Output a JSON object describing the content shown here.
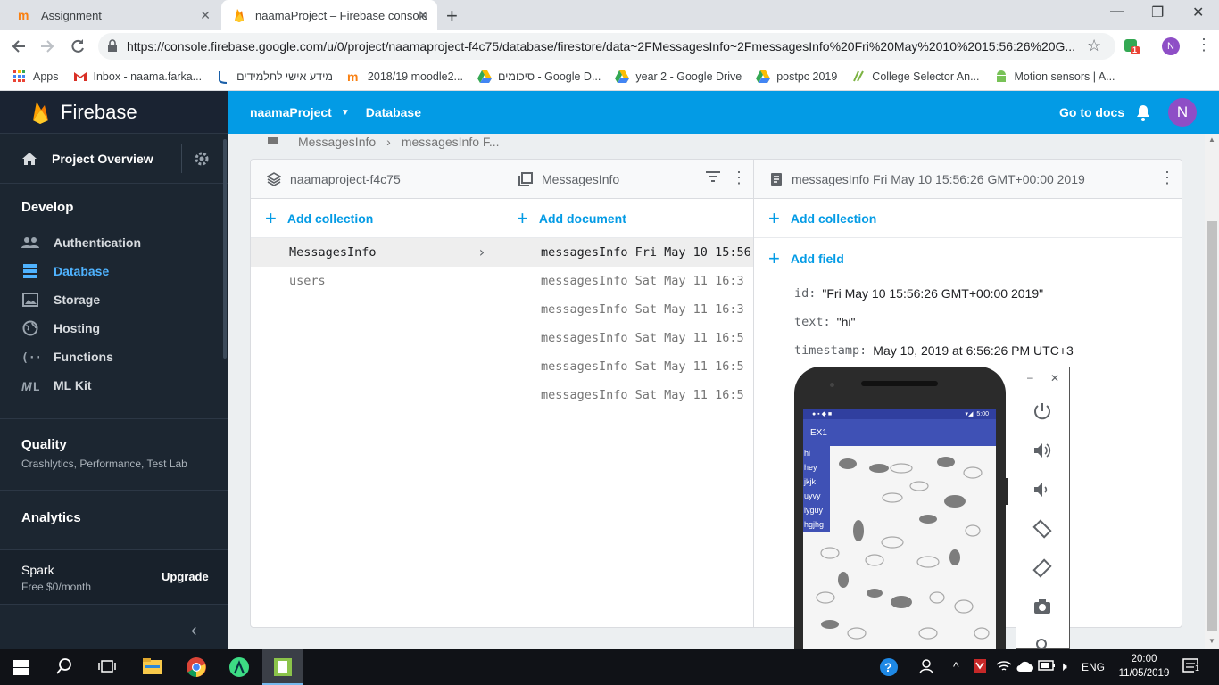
{
  "browser": {
    "tabs": [
      {
        "title": "Assignment"
      },
      {
        "title": "naamaProject – Firebase console"
      }
    ],
    "url": "https://console.firebase.google.com/u/0/project/naamaproject-f4c75/database/firestore/data~2FMessagesInfo~2FmessagesInfo%20Fri%20May%2010%2015:56:26%20G...",
    "extension_badge": "1",
    "profile_initial": "N",
    "bookmarks": [
      {
        "label": "Apps"
      },
      {
        "label": "Inbox - naama.farka..."
      },
      {
        "label": "מידע אישי לתלמידים"
      },
      {
        "label": "2018/19 moodle2..."
      },
      {
        "label": "סיכומים - Google D..."
      },
      {
        "label": "year 2 - Google Drive"
      },
      {
        "label": "postpc 2019"
      },
      {
        "label": "College Selector An..."
      },
      {
        "label": "Motion sensors  |  A..."
      }
    ]
  },
  "sidebar": {
    "brand": "Firebase",
    "project_overview": "Project Overview",
    "develop_title": "Develop",
    "develop_items": [
      {
        "label": "Authentication"
      },
      {
        "label": "Database"
      },
      {
        "label": "Storage"
      },
      {
        "label": "Hosting"
      },
      {
        "label": "Functions"
      },
      {
        "label": "ML Kit"
      }
    ],
    "quality_title": "Quality",
    "quality_sub": "Crashlytics, Performance, Test Lab",
    "analytics_title": "Analytics",
    "plan_name": "Spark",
    "plan_price": "Free $0/month",
    "upgrade": "Upgrade",
    "colors": {
      "bg": "#1c2631",
      "active": "#4fb3ff"
    }
  },
  "topbar": {
    "project": "naamaProject",
    "section": "Database",
    "docs": "Go to docs",
    "avatar": "N",
    "color": "#039be5"
  },
  "breadcrumb": {
    "items": [
      "MessagesInfo",
      "messagesInfo F..."
    ]
  },
  "columns": {
    "root": {
      "title": "naamaproject-f4c75",
      "add": "Add collection",
      "items": [
        "MessagesInfo",
        "users"
      ]
    },
    "collection": {
      "title": "MessagesInfo",
      "add": "Add document",
      "items": [
        "messagesInfo Fri May 10 15:56",
        "messagesInfo Sat May 11 16:3",
        "messagesInfo Sat May 11 16:3",
        "messagesInfo Sat May 11 16:5",
        "messagesInfo Sat May 11 16:5",
        "messagesInfo Sat May 11 16:5"
      ]
    },
    "document": {
      "title": "messagesInfo Fri May 10 15:56:26 GMT+00:00 2019",
      "add_collection": "Add collection",
      "add_field": "Add field",
      "fields": [
        {
          "key": "id:",
          "value": "\"Fri May 10 15:56:26 GMT+00:00 2019\""
        },
        {
          "key": "text:",
          "value": "\"hi\""
        },
        {
          "key": "timestamp:",
          "value": "May 10, 2019 at 6:56:26 PM UTC+3"
        }
      ]
    }
  },
  "emulator": {
    "status_time": "5:00",
    "app_title": "EX1",
    "messages": [
      "hi",
      "hey",
      "jkjk",
      "uyvy",
      "iyguy",
      "hgjhg"
    ]
  },
  "taskbar": {
    "language": "ENG",
    "time": "20:00",
    "date": "11/05/2019",
    "notifications": "1"
  }
}
